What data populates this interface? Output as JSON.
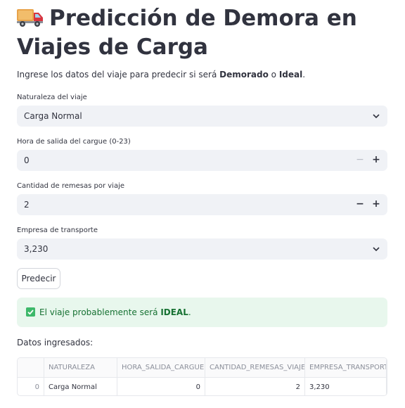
{
  "header": {
    "icon": "delivery-truck-icon",
    "title": "Predicción de Demora en Viajes de Carga",
    "subtitle_prefix": "Ingrese los datos del viaje para predecir si será ",
    "subtitle_bold1": "Demorado",
    "subtitle_mid": " o ",
    "subtitle_bold2": "Ideal",
    "subtitle_suffix": "."
  },
  "form": {
    "naturaleza": {
      "label": "Naturaleza del viaje",
      "value": "Carga Normal"
    },
    "hora": {
      "label": "Hora de salida del cargue (0-23)",
      "value": "0",
      "minus": "−",
      "plus": "+"
    },
    "remesas": {
      "label": "Cantidad de remesas por viaje",
      "value": "2",
      "minus": "−",
      "plus": "+"
    },
    "empresa": {
      "label": "Empresa de transporte",
      "value": "3,230"
    },
    "submit_label": "Predecir"
  },
  "result": {
    "prefix": "El viaje probablemente será ",
    "bold": "IDEAL",
    "suffix": ".",
    "color": "#177233"
  },
  "table": {
    "title": "Datos ingresados:",
    "columns": [
      "",
      "NATURALEZA",
      "HORA_SALIDA_CARGUE",
      "CANTIDAD_REMESAS_VIAJE",
      "EMPRESA_TRANSPORTE"
    ],
    "rows": [
      [
        "0",
        "Carga Normal",
        "0",
        "2",
        "3,230"
      ]
    ]
  }
}
